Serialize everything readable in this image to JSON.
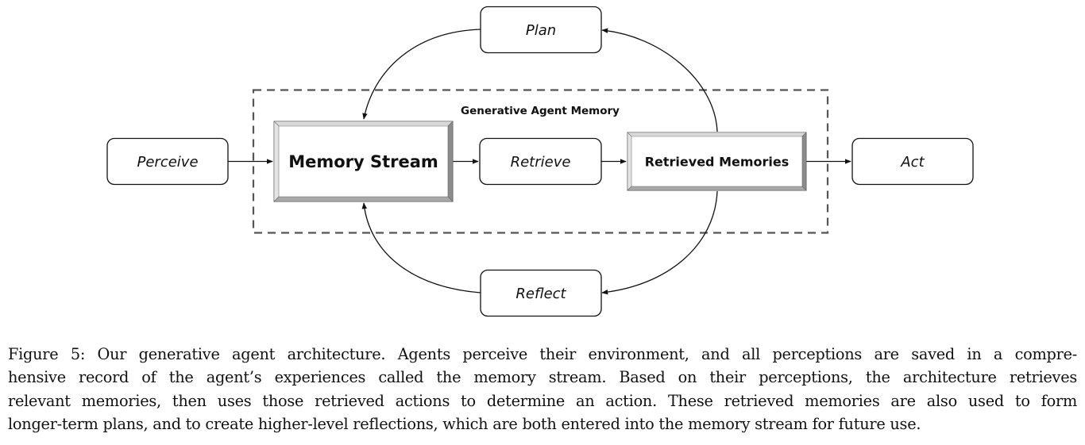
{
  "diagram": {
    "container": {
      "label": "Generative Agent Memory"
    },
    "nodes": {
      "plan": "Plan",
      "perceive": "Perceive",
      "memory_stream": "Memory Stream",
      "retrieve": "Retrieve",
      "retrieved_memories": "Retrieved Memories",
      "act": "Act",
      "reflect": "Reflect"
    },
    "edges": [
      {
        "from": "Perceive",
        "to": "Memory Stream"
      },
      {
        "from": "Memory Stream",
        "to": "Retrieve"
      },
      {
        "from": "Retrieve",
        "to": "Retrieved Memories"
      },
      {
        "from": "Retrieved Memories",
        "to": "Act"
      },
      {
        "from": "Retrieved Memories",
        "to": "Plan"
      },
      {
        "from": "Plan",
        "to": "Memory Stream"
      },
      {
        "from": "Retrieved Memories",
        "to": "Reflect"
      },
      {
        "from": "Reflect",
        "to": "Memory Stream"
      }
    ],
    "colors": {
      "stroke": "#111111",
      "dash": "#555555",
      "bevel_light": "#d9d9d9",
      "bevel_dark": "#8c8c8c"
    }
  },
  "caption": {
    "lines": [
      "Figure 5: Our generative agent architecture. Agents perceive their environment, and all perceptions are saved in a compre-",
      "hensive record of the agent’s experiences called the memory stream. Based on their perceptions, the architecture retrieves",
      "relevant memories, then uses those retrieved actions to determine an action. These retrieved memories are also used to form",
      "longer-term plans, and to create higher-level reflections, which are both entered into the memory stream for future use."
    ]
  }
}
